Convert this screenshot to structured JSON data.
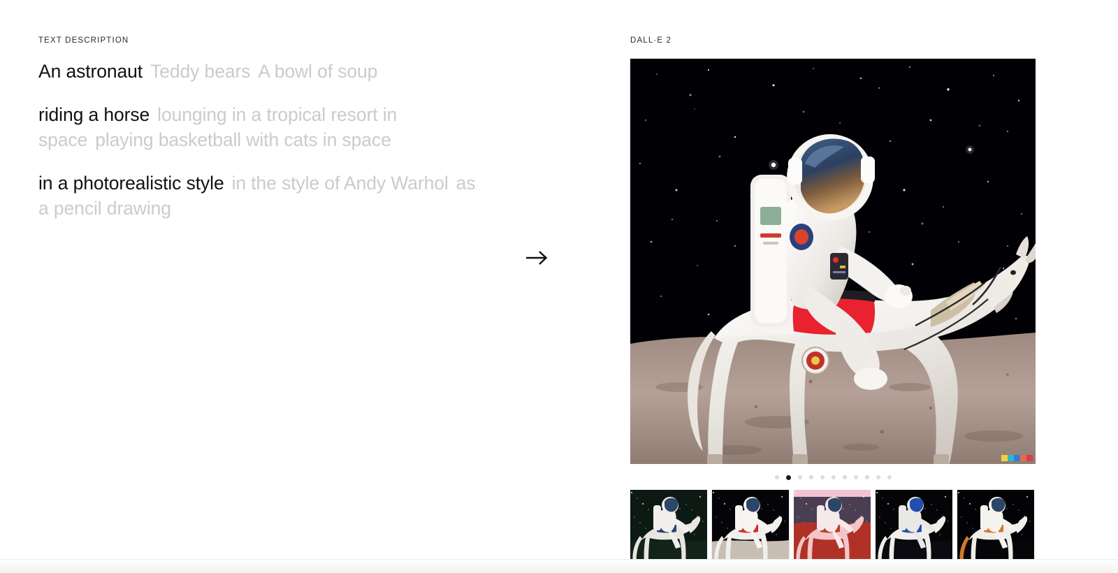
{
  "left": {
    "section_label": "TEXT DESCRIPTION",
    "groups": [
      {
        "name": "subject",
        "options": [
          {
            "text": "An astronaut",
            "selected": true
          },
          {
            "text": "Teddy bears",
            "selected": false
          },
          {
            "text": "A bowl of soup",
            "selected": false
          }
        ]
      },
      {
        "name": "action",
        "options": [
          {
            "text": "riding a horse",
            "selected": true
          },
          {
            "text": "lounging in a tropical resort in space",
            "selected": false
          },
          {
            "text": "playing basketball with cats in space",
            "selected": false
          }
        ]
      },
      {
        "name": "style",
        "options": [
          {
            "text": "in a photorealistic style",
            "selected": true
          },
          {
            "text": "in the style of Andy Warhol",
            "selected": false
          },
          {
            "text": "as a pencil drawing",
            "selected": false
          }
        ]
      }
    ]
  },
  "arrow": {
    "glyph": "→",
    "name": "generate-arrow"
  },
  "right": {
    "model_label": "DALL·E 2",
    "hero": {
      "alt": "An astronaut riding a horse in a photorealistic style",
      "sky": "#000000",
      "ground": "#a79287"
    },
    "swatch_colors": [
      "#f2d23c",
      "#2fb8c6",
      "#2f7fd6",
      "#e8693f",
      "#d63d5a"
    ],
    "carousel": {
      "total_dots": 11,
      "active_index": 1,
      "active_color": "#1b1b1b",
      "inactive_color": "#dcdcdc"
    },
    "thumbnails": [
      {
        "alt": "astronaut on white horse in deep green starfield",
        "bg": "#0d1a13",
        "ground": "#12231a",
        "horse": "#e8e6e0",
        "suit": "#f0efec",
        "accent": "#2b3f7a",
        "active": false
      },
      {
        "alt": "astronaut on white horse on grey lunar surface",
        "bg": "#040409",
        "ground": "#c9beb4",
        "horse": "#f2f0ec",
        "suit": "#f6f5f2",
        "accent": "#d42a34",
        "active": true
      },
      {
        "alt": "astronaut on pink horse on red martian terrain",
        "bg": "#4a3f52",
        "ground": "#b03227",
        "horse": "#f3c5c9",
        "suit": "#f6e9ec",
        "accent": "#c0392b",
        "active": false
      },
      {
        "alt": "astronaut dismounting white horse in black space",
        "bg": "#050508",
        "ground": "#0a0a10",
        "horse": "#efeeea",
        "suit": "#e9e8e4",
        "accent": "#1f4fb0",
        "active": false
      },
      {
        "alt": "astronaut on rearing white horse with orange tail",
        "bg": "#030307",
        "ground": "#060609",
        "horse": "#f0eee9",
        "suit": "#f4f3ef",
        "accent": "#d4792b",
        "active": false
      }
    ]
  }
}
